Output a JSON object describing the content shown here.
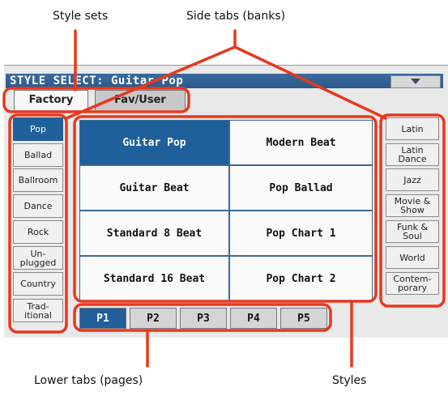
{
  "callouts": {
    "style_sets": "Style sets",
    "side_tabs": "Side tabs (banks)",
    "lower_tabs": "Lower tabs (pages)",
    "styles": "Styles"
  },
  "window": {
    "title": "STYLE SELECT: Guitar Pop",
    "menu_icon": "triangle-down-icon"
  },
  "top_tabs": [
    {
      "label": "Factory",
      "selected": true
    },
    {
      "label": "Fav/User",
      "selected": false
    }
  ],
  "left_tabs": [
    {
      "label": "Pop",
      "selected": true
    },
    {
      "label": "Ballad"
    },
    {
      "label": "Ballroom"
    },
    {
      "label": "Dance"
    },
    {
      "label": "Rock"
    },
    {
      "label": "Un-\nplugged"
    },
    {
      "label": "Country"
    },
    {
      "label": "Trad-\nitional"
    }
  ],
  "right_tabs": [
    {
      "label": "Latin"
    },
    {
      "label": "Latin\nDance"
    },
    {
      "label": "Jazz"
    },
    {
      "label": "Movie &\nShow"
    },
    {
      "label": "Funk &\nSoul"
    },
    {
      "label": "World"
    },
    {
      "label": "Contem-\nporary"
    }
  ],
  "styles": [
    {
      "label": "Guitar Pop",
      "selected": true
    },
    {
      "label": "Modern Beat"
    },
    {
      "label": "Guitar Beat"
    },
    {
      "label": "Pop Ballad"
    },
    {
      "label": "Standard 8 Beat"
    },
    {
      "label": "Pop Chart 1"
    },
    {
      "label": "Standard 16 Beat"
    },
    {
      "label": "Pop Chart 2"
    }
  ],
  "pages": [
    {
      "label": "P1",
      "selected": true
    },
    {
      "label": "P2"
    },
    {
      "label": "P3"
    },
    {
      "label": "P4"
    },
    {
      "label": "P5"
    }
  ],
  "colors": {
    "highlight": "#e8381e",
    "selected_blue": "#1f5f9a"
  }
}
